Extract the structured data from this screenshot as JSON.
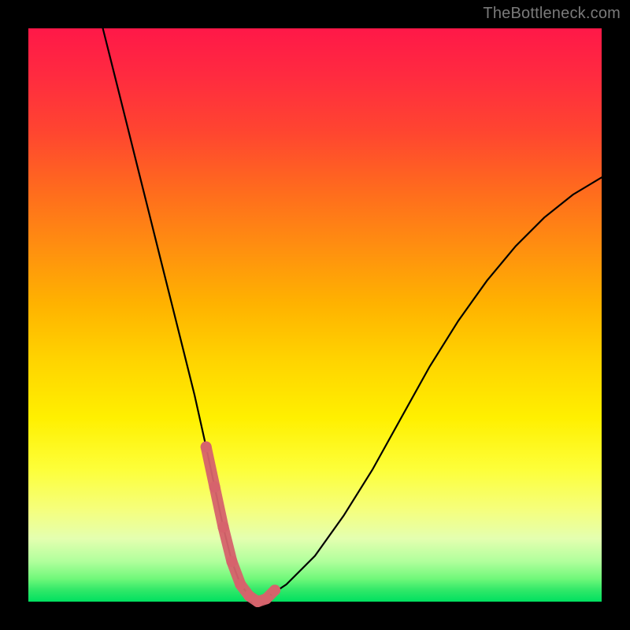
{
  "watermark": "TheBottleneck.com",
  "chart_data": {
    "type": "line",
    "title": "",
    "xlabel": "",
    "ylabel": "",
    "xlim": [
      0,
      100
    ],
    "ylim": [
      0,
      100
    ],
    "series": [
      {
        "name": "bottleneck-curve",
        "x": [
          13,
          15,
          17,
          19,
          21,
          23,
          25,
          27,
          29,
          31,
          32.5,
          34,
          35.5,
          37,
          39,
          40,
          42,
          45,
          50,
          55,
          60,
          65,
          70,
          75,
          80,
          85,
          90,
          95,
          100
        ],
        "y": [
          100,
          92,
          84,
          76,
          68,
          60,
          52,
          44,
          36,
          27,
          20,
          13,
          7,
          3,
          0.5,
          0,
          1,
          3,
          8,
          15,
          23,
          32,
          41,
          49,
          56,
          62,
          67,
          71,
          74
        ]
      }
    ],
    "highlight": {
      "name": "optimal-band",
      "color": "#d6636c",
      "x": [
        31,
        32.5,
        34,
        35.5,
        37,
        38.5,
        40,
        41.5,
        43
      ],
      "y": [
        27,
        20,
        13,
        7,
        3,
        1,
        0,
        0.5,
        2
      ]
    }
  }
}
